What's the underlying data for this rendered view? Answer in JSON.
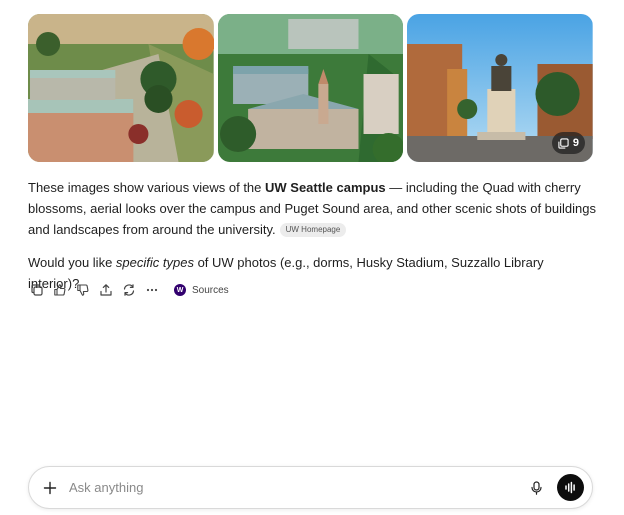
{
  "gallery": {
    "images": [
      {
        "label": "UW Quad aerial view with autumn trees",
        "icon": "photo"
      },
      {
        "label": "Aerial view of UW Seattle campus buildings",
        "icon": "photo"
      },
      {
        "label": "Statue on UW campus plaza",
        "icon": "photo"
      }
    ],
    "more_count": "9"
  },
  "answer": {
    "p1_a": "These images show various views of the ",
    "p1_bold": "UW Seattle campus",
    "p1_b": " — including the Quad with cherry blossoms, aerial looks over the campus and Puget Sound area, and other scenic shots of buildings and landscapes from around the university.",
    "citation": "UW Homepage",
    "p2_a": "Would you like ",
    "p2_em": "specific types",
    "p2_b": " of UW photos (e.g., dorms, Husky Stadium, Suzzallo Library interior)?"
  },
  "actions": {
    "icons": [
      "copy-icon",
      "thumbs-up-icon",
      "thumbs-down-icon",
      "share-icon",
      "regenerate-icon",
      "more-icon"
    ],
    "sources_logo": "W",
    "sources_label": "Sources"
  },
  "composer": {
    "placeholder": "Ask anything",
    "value": ""
  },
  "colors": {
    "voice_button": "#0d0d0d",
    "source_logo": "#32006e",
    "citation_bg": "#ececec"
  }
}
